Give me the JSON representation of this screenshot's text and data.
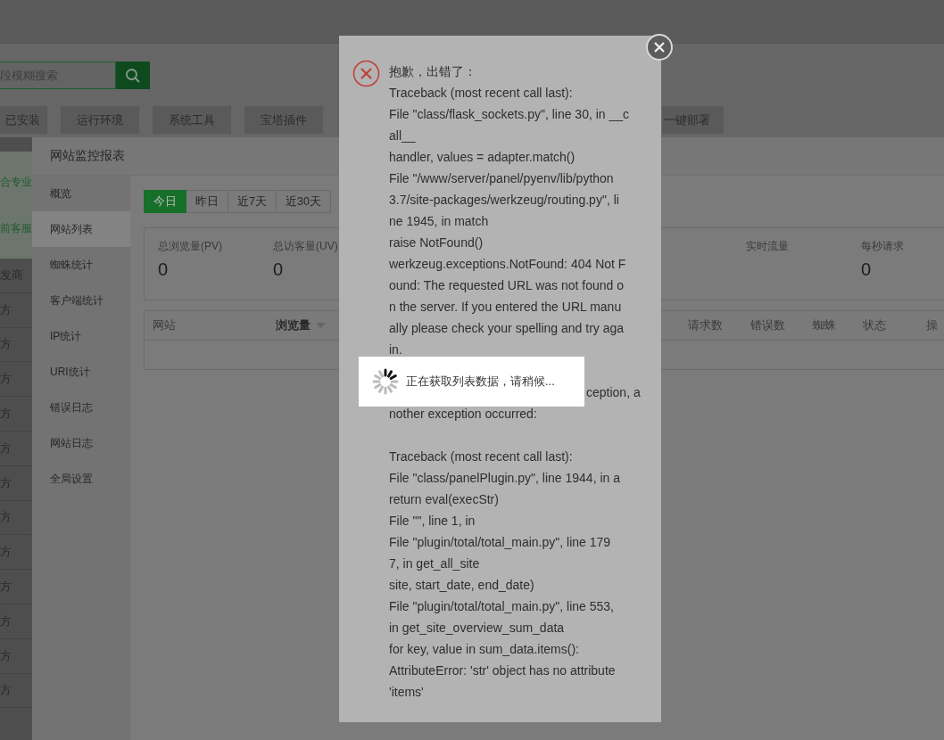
{
  "base_page": {
    "search": {
      "placeholder": "段模糊搜索"
    },
    "tabs_left": [
      "已安装",
      "运行环境",
      "系统工具",
      "宝塔插件"
    ],
    "tabs_right": [
      "一键部署"
    ],
    "notice_lines": [
      "合专业",
      "前客服"
    ],
    "list_rows": [
      "发商",
      "方",
      "方",
      "方",
      "方",
      "方",
      "方",
      "方",
      "方",
      "方",
      "方",
      "方",
      "方"
    ]
  },
  "report_modal": {
    "title": "网站监控报表",
    "nav": [
      {
        "label": "概览",
        "selected": false
      },
      {
        "label": "网站列表",
        "selected": true
      },
      {
        "label": "蜘蛛统计",
        "selected": false
      },
      {
        "label": "客户端统计",
        "selected": false
      },
      {
        "label": "IP统计",
        "selected": false
      },
      {
        "label": "URI统计",
        "selected": false
      },
      {
        "label": "错误日志",
        "selected": false
      },
      {
        "label": "网站日志",
        "selected": false
      },
      {
        "label": "全局设置",
        "selected": false
      }
    ],
    "date_tabs": [
      {
        "label": "今日",
        "selected": true
      },
      {
        "label": "昨日",
        "selected": false
      },
      {
        "label": "近7天",
        "selected": false
      },
      {
        "label": "近30天",
        "selected": false
      }
    ],
    "stats_left": [
      {
        "label": "总浏览量(PV)",
        "value": "0"
      },
      {
        "label": "总访客量(UV)",
        "value": "0"
      }
    ],
    "stats_right": [
      {
        "label": "实时流量"
      },
      {
        "label": "每秒请求",
        "value": "0"
      }
    ],
    "table": {
      "columns_left": [
        {
          "label": "网站",
          "sorted": false
        },
        {
          "label": "浏览量",
          "sorted": true
        }
      ],
      "columns_right": [
        {
          "label": "请求数",
          "sorted": false
        },
        {
          "label": "错误数",
          "sorted": false
        },
        {
          "label": "蜘蛛",
          "sorted": false
        },
        {
          "label": "状态",
          "sorted": false
        },
        {
          "label": "操",
          "sorted": false
        }
      ]
    }
  },
  "error_dialog": {
    "title": "抱歉，出错了：",
    "blocks": [
      {
        "first_line_covered": false,
        "lines": [
          "Traceback (most recent call last):",
          "File \"class/flask_sockets.py\", line 30, in __c",
          "all__",
          "handler, values = adapter.match()",
          "File \"/www/server/panel/pyenv/lib/python",
          "3.7/site-packages/werkzeug/routing.py\", li",
          "ne 1945, in match",
          "raise NotFound()",
          "werkzeug.exceptions.NotFound: 404 Not F",
          "ound: The requested URL was not found o",
          "n the server. If you entered the URL manu",
          "ally please check your spelling and try aga",
          "in."
        ]
      },
      {
        "first_line_covered": true,
        "lines": [
          "ception, a",
          "nother exception occurred:"
        ]
      },
      {
        "first_line_covered": false,
        "lines": [
          "Traceback (most recent call last):",
          "File \"class/panelPlugin.py\", line 1944, in a",
          "return eval(execStr)",
          "File \"\", line 1, in",
          "File \"plugin/total/total_main.py\", line 179",
          "7, in get_all_site",
          "site, start_date, end_date)",
          "File \"plugin/total/total_main.py\", line 553,",
          "in get_site_overview_sum_data",
          "for key, value in sum_data.items():",
          "AttributeError: 'str' object has no attribute",
          "'items'"
        ]
      }
    ]
  },
  "loading_toast": {
    "text": "正在获取列表数据，请稍候..."
  }
}
